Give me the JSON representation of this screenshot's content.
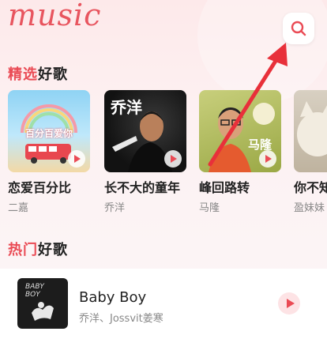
{
  "header": {
    "logo_text": "music"
  },
  "featured": {
    "title_red": "精选",
    "title_black": "好歌",
    "items": [
      {
        "title": "恋爱百分比",
        "artist": "二嘉",
        "cover_text": "百分百爱你"
      },
      {
        "title": "长不大的童年",
        "artist": "乔洋",
        "cover_text": "乔洋"
      },
      {
        "title": "峰回路转",
        "artist": "马隆",
        "cover_text": "马隆"
      },
      {
        "title": "你不知",
        "artist": "盈妹妹"
      }
    ]
  },
  "hot": {
    "title_red": "热门",
    "title_black": "好歌",
    "items": [
      {
        "title": "Baby Boy",
        "artist": "乔洋、Jossvit姜寒",
        "cover_text": "BABY BOY"
      }
    ]
  },
  "colors": {
    "accent": "#ea4b55",
    "background": "#fdeeef"
  }
}
